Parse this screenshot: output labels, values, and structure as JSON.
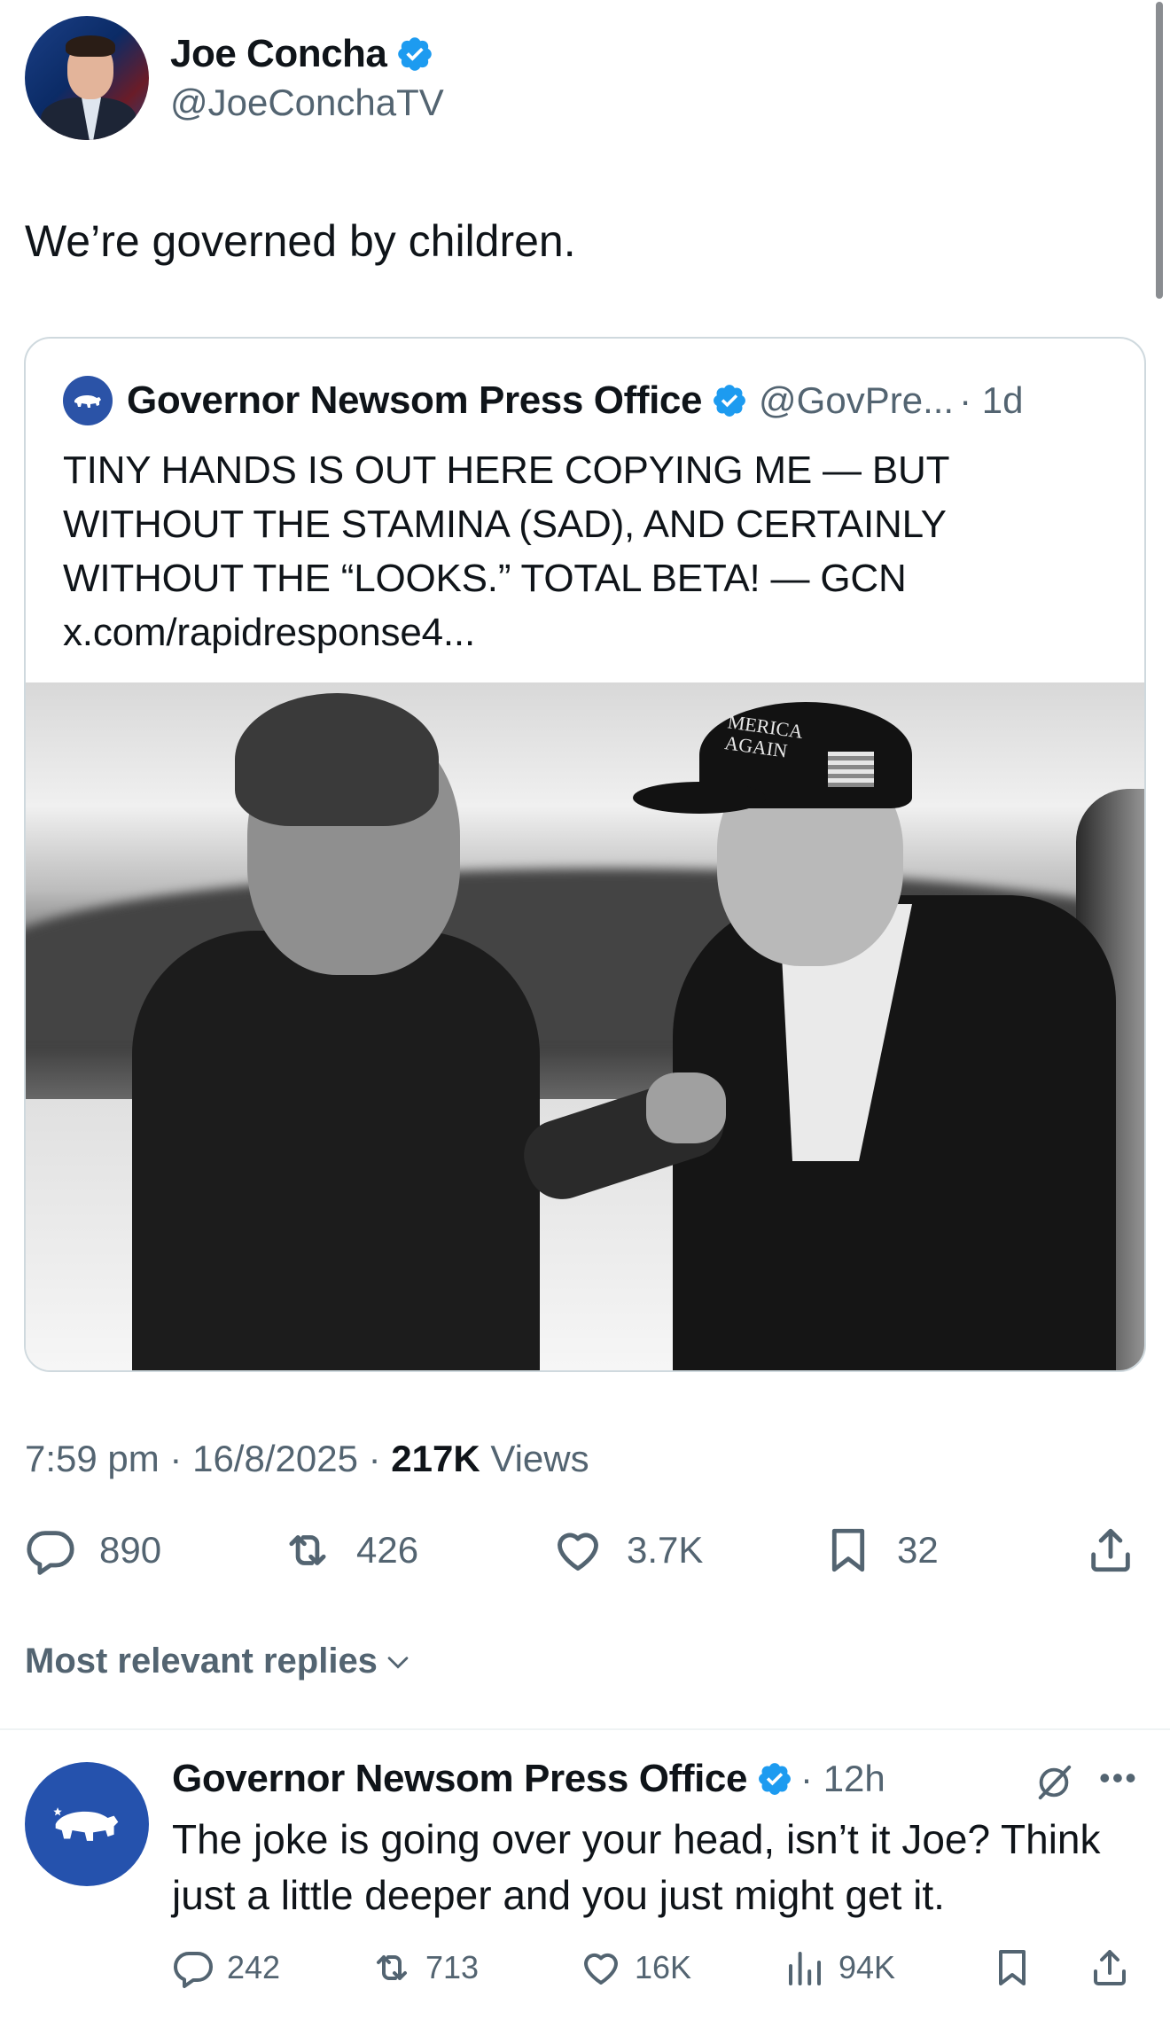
{
  "author": {
    "name": "Joe Concha",
    "handle": "@JoeConchaTV"
  },
  "tweet": {
    "text": "We’re governed by children."
  },
  "quote": {
    "name": "Governor Newsom Press Office",
    "handle": "@GovPre...",
    "time": "· 1d",
    "lines": [
      "TINY HANDS IS OUT HERE COPYING ME — BUT",
      "WITHOUT THE STAMINA (SAD), AND CERTAINLY",
      "WITHOUT THE “LOOKS.” TOTAL BETA! — GCN",
      "x.com/rapidresponse4..."
    ],
    "photo_hat_text": "MERICA\nAGAIN"
  },
  "meta": {
    "time": "7:59 pm · 16/8/2025 · ",
    "views_count": "217K",
    "views_label": " Views"
  },
  "actions": {
    "replies": "890",
    "reposts": "426",
    "likes": "3.7K",
    "bookmarks": "32"
  },
  "replies_filter": {
    "label": "Most relevant replies"
  },
  "reply": {
    "name": "Governor Newsom Press Office",
    "time": "· 12h",
    "text": "The joke is going over your head, isn’t it Joe? Think just a little deeper and you just might get it.",
    "replies": "242",
    "reposts": "713",
    "likes": "16K",
    "views": "94K"
  },
  "colors": {
    "verified": "#1d9bf0",
    "secondary_text": "#536471",
    "primary_text": "#0f1419",
    "border": "#cfd9de",
    "newsom_avatar": "#2552ad"
  },
  "icons": [
    "verified-badge-icon",
    "reply-icon",
    "repost-icon",
    "like-icon",
    "bookmark-icon",
    "share-icon",
    "views-icon",
    "grok-icon",
    "more-icon",
    "chevron-down-icon",
    "bear-icon"
  ]
}
